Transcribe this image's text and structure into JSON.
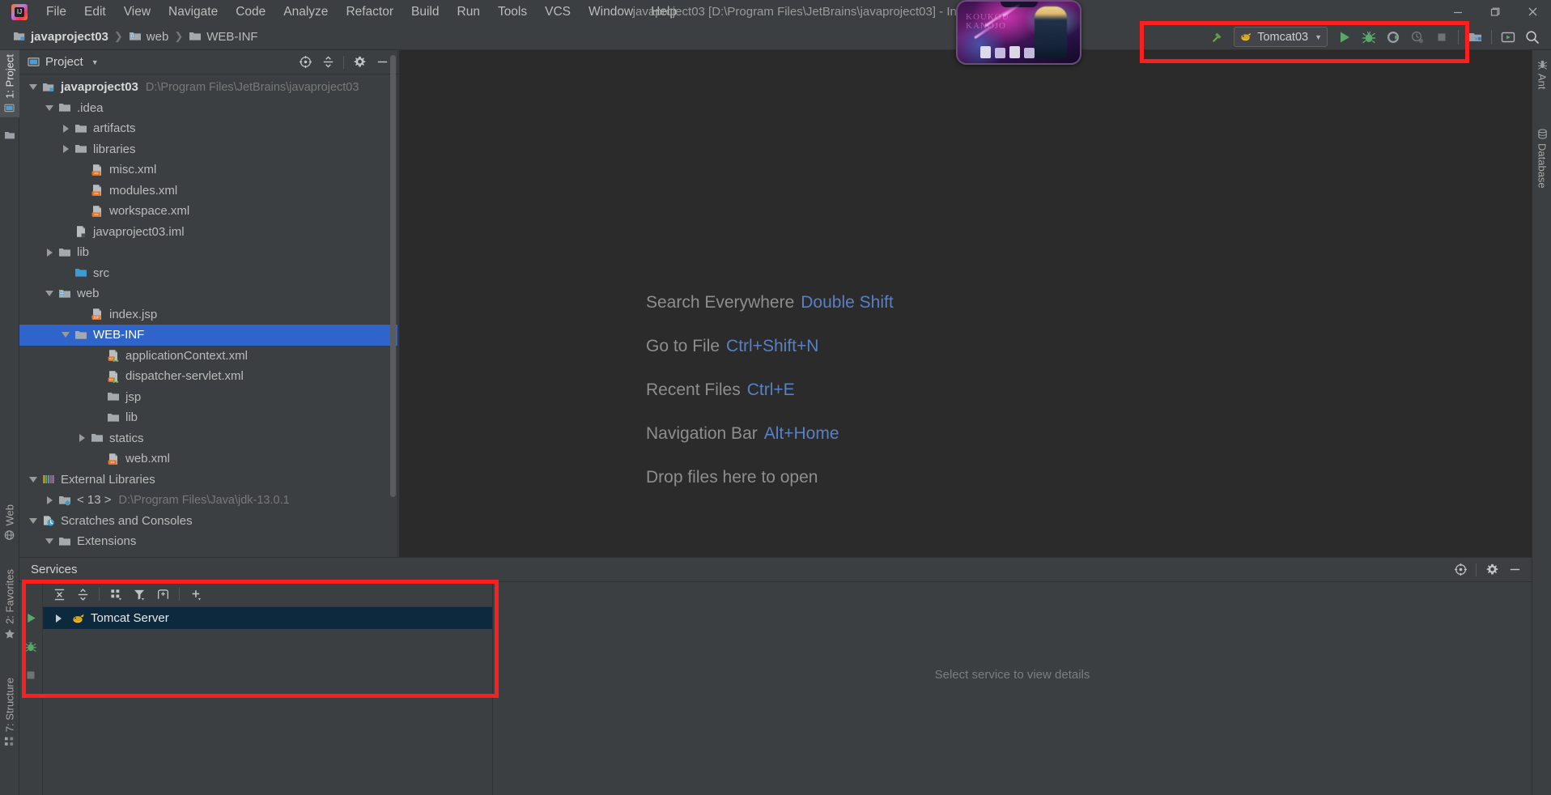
{
  "window": {
    "title": "javaproject03 [D:\\Program Files\\JetBrains\\javaproject03] - Inte",
    "minimize_label": "—",
    "maximize_label": "❐",
    "close_label": "✕",
    "logo_name": "intellij-idea-logo"
  },
  "menu": {
    "items": [
      {
        "label": "File"
      },
      {
        "label": "Edit"
      },
      {
        "label": "View"
      },
      {
        "label": "Navigate"
      },
      {
        "label": "Code"
      },
      {
        "label": "Analyze"
      },
      {
        "label": "Refactor"
      },
      {
        "label": "Build"
      },
      {
        "label": "Run"
      },
      {
        "label": "Tools"
      },
      {
        "label": "VCS"
      },
      {
        "label": "Window"
      },
      {
        "label": "Help"
      }
    ]
  },
  "navbar": {
    "crumbs": [
      {
        "label": "javaproject03",
        "icon": "module-icon"
      },
      {
        "label": "web",
        "icon": "web-folder-icon"
      },
      {
        "label": "WEB-INF",
        "icon": "folder-icon"
      }
    ],
    "separator": "❯"
  },
  "run_toolbar": {
    "build_tooltip": "Build Project",
    "run_config_name": "Tomcat03",
    "run_config_icon": "tomcat-icon",
    "dropdown_glyph": "▼",
    "buttons": [
      {
        "name": "run-button",
        "label": "Run"
      },
      {
        "name": "debug-button",
        "label": "Debug"
      },
      {
        "name": "run-with-coverage-button",
        "label": "Run with Coverage"
      },
      {
        "name": "profile-button",
        "label": "Profile"
      },
      {
        "name": "stop-button",
        "label": "Stop"
      }
    ],
    "extra": [
      {
        "name": "project-structure-button",
        "label": "Project Structure"
      },
      {
        "name": "updates-button",
        "label": "Update"
      },
      {
        "name": "search-everywhere-button",
        "label": "Search Everywhere"
      }
    ]
  },
  "stripes": {
    "left_top": [
      {
        "label": "1: Project",
        "icon": "project-icon",
        "active": true
      }
    ],
    "left_extra_icon": "folder-icon",
    "left_bottom": [
      {
        "label": "Web",
        "icon": "web-icon"
      },
      {
        "label": "2: Favorites",
        "icon": "star-icon"
      },
      {
        "label": "7: Structure",
        "icon": "structure-icon"
      }
    ],
    "right": [
      {
        "label": "Ant",
        "icon": "ant-icon"
      },
      {
        "label": "Database",
        "icon": "database-icon"
      }
    ]
  },
  "project_panel": {
    "title": "Project",
    "dropdown_glyph": "▼",
    "actions": [
      {
        "name": "scroll-from-source-button",
        "label": "Select Opened File"
      },
      {
        "name": "collapse-all-button",
        "label": "Collapse All"
      },
      {
        "name": "settings-gear-button",
        "label": "Settings"
      },
      {
        "name": "hide-panel-button",
        "label": "Hide"
      }
    ],
    "tree": [
      {
        "indent": 0,
        "twisty": "down",
        "icon": "module-icon",
        "label": "javaproject03",
        "bold": true,
        "sub": "D:\\Program Files\\JetBrains\\javaproject03"
      },
      {
        "indent": 1,
        "twisty": "down",
        "icon": "folder-icon",
        "label": ".idea"
      },
      {
        "indent": 2,
        "twisty": "right",
        "icon": "folder-icon",
        "label": "artifacts"
      },
      {
        "indent": 2,
        "twisty": "right",
        "icon": "folder-icon",
        "label": "libraries"
      },
      {
        "indent": 3,
        "twisty": "none",
        "icon": "xml-file-icon",
        "label": "misc.xml"
      },
      {
        "indent": 3,
        "twisty": "none",
        "icon": "xml-file-icon",
        "label": "modules.xml"
      },
      {
        "indent": 3,
        "twisty": "none",
        "icon": "xml-file-icon",
        "label": "workspace.xml"
      },
      {
        "indent": 2,
        "twisty": "none",
        "icon": "iml-file-icon",
        "label": "javaproject03.iml"
      },
      {
        "indent": 1,
        "twisty": "right",
        "icon": "folder-icon",
        "label": "lib"
      },
      {
        "indent": 2,
        "twisty": "none",
        "icon": "source-folder-icon",
        "label": "src"
      },
      {
        "indent": 1,
        "twisty": "down",
        "icon": "web-folder-icon",
        "label": "web"
      },
      {
        "indent": 3,
        "twisty": "none",
        "icon": "jsp-file-icon",
        "label": "index.jsp"
      },
      {
        "indent": 2,
        "twisty": "down",
        "icon": "folder-icon",
        "label": "WEB-INF",
        "selected": true
      },
      {
        "indent": 4,
        "twisty": "none",
        "icon": "spring-xml-icon",
        "label": "applicationContext.xml"
      },
      {
        "indent": 4,
        "twisty": "none",
        "icon": "spring-xml-icon",
        "label": "dispatcher-servlet.xml"
      },
      {
        "indent": 4,
        "twisty": "none",
        "icon": "folder-icon",
        "label": "jsp"
      },
      {
        "indent": 4,
        "twisty": "none",
        "icon": "folder-icon",
        "label": "lib"
      },
      {
        "indent": 3,
        "twisty": "right",
        "icon": "folder-icon",
        "label": "statics"
      },
      {
        "indent": 4,
        "twisty": "none",
        "icon": "xml-file-icon",
        "label": "web.xml"
      },
      {
        "indent": 0,
        "twisty": "down",
        "icon": "libraries-icon",
        "label": "External Libraries"
      },
      {
        "indent": 1,
        "twisty": "right",
        "icon": "jdk-icon",
        "label": "< 13 >",
        "sub": "D:\\Program Files\\Java\\jdk-13.0.1"
      },
      {
        "indent": 0,
        "twisty": "down",
        "icon": "scratches-icon",
        "label": "Scratches and Consoles"
      },
      {
        "indent": 1,
        "twisty": "down",
        "icon": "folder-icon",
        "label": "Extensions"
      }
    ]
  },
  "editor": {
    "hints": [
      {
        "action": "Search Everywhere",
        "shortcut": "Double Shift"
      },
      {
        "action": "Go to File",
        "shortcut": "Ctrl+Shift+N"
      },
      {
        "action": "Recent Files",
        "shortcut": "Ctrl+E"
      },
      {
        "action": "Navigation Bar",
        "shortcut": "Alt+Home"
      },
      {
        "action": "Drop files here to open",
        "shortcut": ""
      }
    ]
  },
  "services": {
    "title": "Services",
    "header_actions": [
      {
        "name": "help-target-button",
        "label": "Help"
      },
      {
        "name": "settings-gear-button",
        "label": "Settings"
      },
      {
        "name": "hide-panel-button",
        "label": "Hide"
      }
    ],
    "run_sidebar": [
      {
        "name": "run-service-button",
        "label": "Run"
      },
      {
        "name": "debug-service-button",
        "label": "Debug"
      },
      {
        "name": "stop-service-button",
        "label": "Stop"
      }
    ],
    "toolbar": [
      {
        "name": "run-button",
        "label": "Run"
      },
      {
        "name": "expand-all-button",
        "label": "Expand All"
      },
      {
        "name": "collapse-all-button",
        "label": "Collapse All"
      },
      {
        "name": "group-by-button",
        "label": "Group By"
      },
      {
        "name": "filter-button",
        "label": "Filter"
      },
      {
        "name": "add-tab-button",
        "label": "Add Tab"
      },
      {
        "name": "add-button",
        "label": "Add Service"
      }
    ],
    "items": [
      {
        "label": "Tomcat Server",
        "icon": "tomcat-icon",
        "twisty": "right",
        "selected": true
      }
    ],
    "details_placeholder": "Select service to view details"
  },
  "annotations": {
    "boxes": [
      {
        "name": "run-toolbar-highlight"
      },
      {
        "name": "services-panel-highlight"
      }
    ],
    "color": "#fc1f1f"
  },
  "overlay": {
    "name": "floating-wallpaper-thumbnail"
  },
  "colors": {
    "bg": "#3c3f41",
    "editor_bg": "#2b2b2b",
    "selection": "#2f65ca",
    "accent_blue": "#5781c4",
    "run_green": "#499c54",
    "annotation_red": "#fc1f1f"
  }
}
